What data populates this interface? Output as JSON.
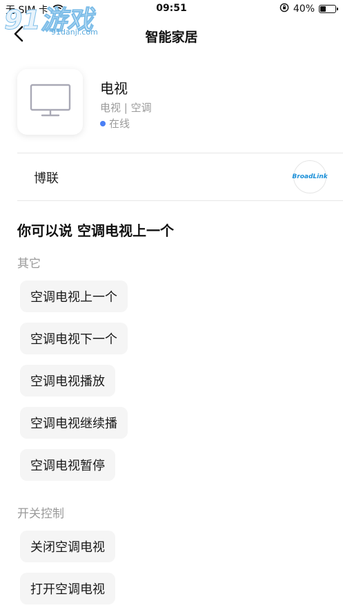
{
  "status_bar": {
    "carrier": "无 SIM 卡",
    "time": "09:51",
    "battery_percent": "40%",
    "battery_level": 0.4,
    "icons": [
      "wifi-icon",
      "orientation-lock-icon",
      "battery-icon"
    ]
  },
  "watermark": {
    "main": "91游戏",
    "sub": "91danji.com"
  },
  "nav": {
    "title": "智能家居",
    "back_icon": "chevron-left-icon"
  },
  "device": {
    "name": "电视",
    "type": "电视 | 空调",
    "status": "在线",
    "status_color": "#4a7ff5",
    "icon": "tv-icon"
  },
  "brand": {
    "name": "博联",
    "logo_text": "BroadLink",
    "logo_color": "#1a8fd8"
  },
  "suggestions": {
    "heading": "你可以说 空调电视上一个",
    "sections": [
      {
        "label": "其它",
        "items": [
          "空调电视上一个",
          "空调电视下一个",
          "空调电视播放",
          "空调电视继续播",
          "空调电视暂停"
        ]
      },
      {
        "label": "开关控制",
        "items": [
          "关闭空调电视",
          "打开空调电视"
        ]
      }
    ]
  }
}
